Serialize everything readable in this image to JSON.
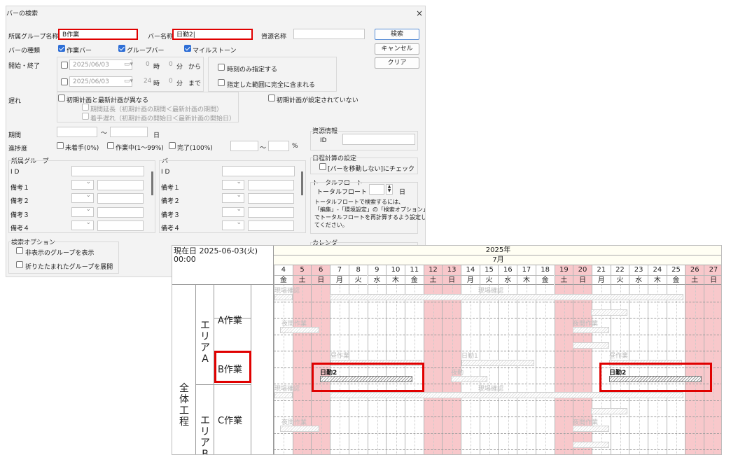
{
  "dialog": {
    "title": "バーの検索",
    "close": "×",
    "labels": {
      "group_name": "所属グループ名称",
      "bar_name": "バー名称",
      "resource_name": "資源名称",
      "bar_type": "バーの種類",
      "start_end": "開始・終了",
      "delay": "遅れ",
      "period": "期間",
      "progress": "進捗度",
      "group_section": "所属グループ",
      "bar_section": "バー",
      "resource_info": "資源情報",
      "id": "ID",
      "id_spaced": "I D",
      "schedule_settings": "日程計算の設定",
      "total_float_section": "トータルフロート",
      "total_float": "トータルフロート　≦",
      "day_unit": "日",
      "percent": "%",
      "tilde": "～",
      "remarks1": "備考１",
      "remarks2": "備考２",
      "remarks3": "備考３",
      "remarks4": "備考４",
      "search_options": "検索オプション",
      "calendar": "カレンダー",
      "hour": "時",
      "minute": "分",
      "from": "から",
      "until": "まで"
    },
    "values": {
      "group_name": "B作業",
      "bar_name": "日勤2|",
      "start_date": "2025/06/03",
      "end_date": "2025/06/03",
      "start_hour": "0",
      "start_min": "0",
      "end_hour": "24",
      "end_min": "0"
    },
    "checks": {
      "work_bar": "作業バー",
      "group_bar": "グループバー",
      "milestone": "マイルストーン",
      "time_only": "時刻のみ指定する",
      "fully_in_range": "指定した範囲に完全に含まれる",
      "plan_differs": "初期計画と最新計画が異なる",
      "period_extension": "期間延長（初期計画の期間＜最新計画の期間）",
      "start_delay": "着手遅れ（初期計画の開始日＜最新計画の開始日）",
      "no_initial_plan": "初期計画が設定されていない",
      "not_started": "未着手(0%)",
      "in_progress": "作業中(1～99%)",
      "completed": "完了(100%)",
      "dont_move_bar": "[バーを移動しない]にチェック",
      "show_hidden_groups": "非表示のグループを表示",
      "expand_folded_groups": "折りたたまれたグループを展開"
    },
    "buttons": {
      "search": "検索",
      "cancel": "キャンセル",
      "clear": "クリア"
    },
    "float_note": [
      "トータルフロートで検索するには、",
      "「編集」-「環境設定」の「検索オプション」",
      "でトータルフロートを再計算するよう設定し",
      "てください。"
    ]
  },
  "gantt": {
    "current_date": "現在日 2025-06-03(火)",
    "current_time": "00:00",
    "year": "2025年",
    "month": "7月",
    "days": [
      {
        "n": "4",
        "w": "金",
        "we": false
      },
      {
        "n": "5",
        "w": "土",
        "we": true
      },
      {
        "n": "6",
        "w": "日",
        "we": true
      },
      {
        "n": "7",
        "w": "月",
        "we": false
      },
      {
        "n": "8",
        "w": "火",
        "we": false
      },
      {
        "n": "9",
        "w": "水",
        "we": false
      },
      {
        "n": "10",
        "w": "木",
        "we": false
      },
      {
        "n": "11",
        "w": "金",
        "we": false
      },
      {
        "n": "12",
        "w": "土",
        "we": true
      },
      {
        "n": "13",
        "w": "日",
        "we": true
      },
      {
        "n": "14",
        "w": "月",
        "we": false
      },
      {
        "n": "15",
        "w": "火",
        "we": false
      },
      {
        "n": "16",
        "w": "水",
        "we": false
      },
      {
        "n": "17",
        "w": "木",
        "we": false
      },
      {
        "n": "18",
        "w": "金",
        "we": false
      },
      {
        "n": "19",
        "w": "土",
        "we": true
      },
      {
        "n": "20",
        "w": "日",
        "we": true
      },
      {
        "n": "21",
        "w": "月",
        "we": false
      },
      {
        "n": "22",
        "w": "火",
        "we": false
      },
      {
        "n": "23",
        "w": "水",
        "we": false
      },
      {
        "n": "24",
        "w": "木",
        "we": false
      },
      {
        "n": "25",
        "w": "金",
        "we": false
      },
      {
        "n": "26",
        "w": "土",
        "we": true
      },
      {
        "n": "27",
        "w": "日",
        "we": true
      }
    ],
    "tree": {
      "root": "全体工程",
      "area_a": "エリアA",
      "area_b": "エリアB",
      "work_a": "A作業",
      "work_b": "B作業",
      "work_c": "C作業"
    },
    "bar_labels": {
      "site_check": "現場確認",
      "night_work": "夜間作業",
      "day_work": "昼作業",
      "day_shift1": "日勤1",
      "day_shift2": "日勤2",
      "night_shift": "夜勤"
    }
  }
}
